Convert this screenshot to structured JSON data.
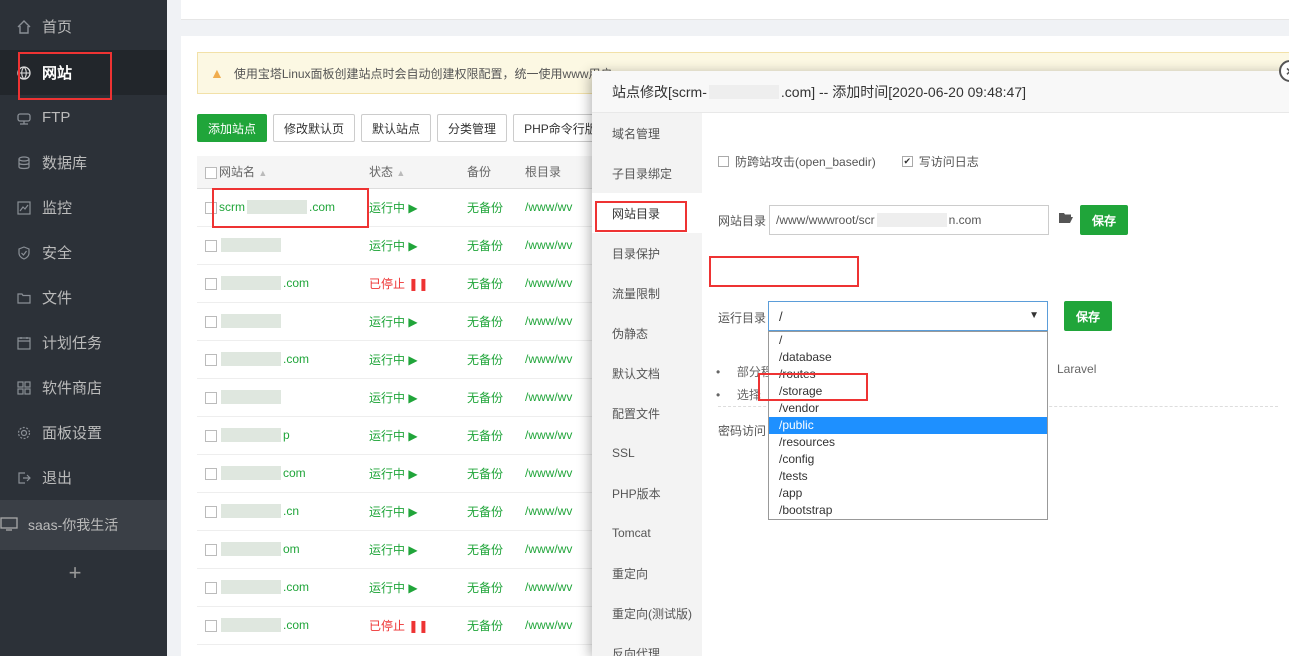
{
  "sidebar": {
    "items": [
      {
        "label": "首页",
        "icon": "home-icon"
      },
      {
        "label": "网站",
        "icon": "globe-icon"
      },
      {
        "label": "FTP",
        "icon": "ftp-icon"
      },
      {
        "label": "数据库",
        "icon": "database-icon"
      },
      {
        "label": "监控",
        "icon": "monitor-icon"
      },
      {
        "label": "安全",
        "icon": "shield-icon"
      },
      {
        "label": "文件",
        "icon": "folder-icon"
      },
      {
        "label": "计划任务",
        "icon": "calendar-icon"
      },
      {
        "label": "软件商店",
        "icon": "apps-icon"
      },
      {
        "label": "面板设置",
        "icon": "gear-icon"
      },
      {
        "label": "退出",
        "icon": "logout-icon"
      }
    ],
    "group_label": "saas-你我生活",
    "plus": "+"
  },
  "notice": "使用宝塔Linux面板创建站点时会自动创建权限配置，统一使用www用户",
  "toolbar": {
    "add_site": "添加站点",
    "edit_default_page": "修改默认页",
    "default_site": "默认站点",
    "category": "分类管理",
    "php_cli": "PHP命令行版本"
  },
  "table": {
    "headers": {
      "name": "网站名",
      "status": "状态",
      "backup": "备份",
      "root": "根目录"
    },
    "rows": [
      {
        "prefix": "scrm",
        "suffix": ".com",
        "status": "运行中",
        "backup": "无备份",
        "root": "/www/wv"
      },
      {
        "prefix": "",
        "suffix": "",
        "status": "运行中",
        "backup": "无备份",
        "root": "/www/wv"
      },
      {
        "prefix": "",
        "suffix": ".com",
        "status": "已停止",
        "backup": "无备份",
        "root": "/www/wv"
      },
      {
        "prefix": "",
        "suffix": "",
        "status": "运行中",
        "backup": "无备份",
        "root": "/www/wv"
      },
      {
        "prefix": "",
        "suffix": ".com",
        "status": "运行中",
        "backup": "无备份",
        "root": "/www/wv"
      },
      {
        "prefix": "",
        "suffix": "",
        "status": "运行中",
        "backup": "无备份",
        "root": "/www/wv"
      },
      {
        "prefix": "",
        "suffix": "p",
        "status": "运行中",
        "backup": "无备份",
        "root": "/www/wv"
      },
      {
        "prefix": "",
        "suffix": "com",
        "status": "运行中",
        "backup": "无备份",
        "root": "/www/wv"
      },
      {
        "prefix": "",
        "suffix": ".cn",
        "status": "运行中",
        "backup": "无备份",
        "root": "/www/wv"
      },
      {
        "prefix": "",
        "suffix": "om",
        "status": "运行中",
        "backup": "无备份",
        "root": "/www/wv"
      },
      {
        "prefix": "",
        "suffix": ".com",
        "status": "运行中",
        "backup": "无备份",
        "root": "/www/wv"
      },
      {
        "prefix": "",
        "suffix": ".com",
        "status": "已停止",
        "backup": "无备份",
        "root": "/www/wv"
      }
    ]
  },
  "modal": {
    "title": "站点修改[scrm-",
    "title_rest": ".com] -- 添加时间[2020-06-20 09:48:47]",
    "tabs": [
      "域名管理",
      "子目录绑定",
      "网站目录",
      "目录保护",
      "流量限制",
      "伪静态",
      "默认文档",
      "配置文件",
      "SSL",
      "PHP版本",
      "Tomcat",
      "重定向",
      "重定向(测试版)",
      "反向代理"
    ],
    "basedir_label": "防跨站攻击(open_basedir)",
    "log_label": "写访问日志",
    "site_dir_label": "网站目录",
    "site_dir_value_a": "/www/wwwroot/scr",
    "site_dir_value_b": "n.com",
    "save_label": "保存",
    "run_dir_label": "运行目录",
    "run_dir_value": "/",
    "run_dir_options": [
      "/",
      "/database",
      "/routes",
      "/storage",
      "/vendor",
      "/public",
      "/resources",
      "/config",
      "/tests",
      "/app",
      "/bootstrap"
    ],
    "bullet1": "部分程",
    "bullet1_tail": "Laravel",
    "bullet2": "选择",
    "password_label": "密码访问"
  },
  "colors": {
    "accent": "#20a53a",
    "danger": "#e33333",
    "sidebar": "#2c3138"
  }
}
